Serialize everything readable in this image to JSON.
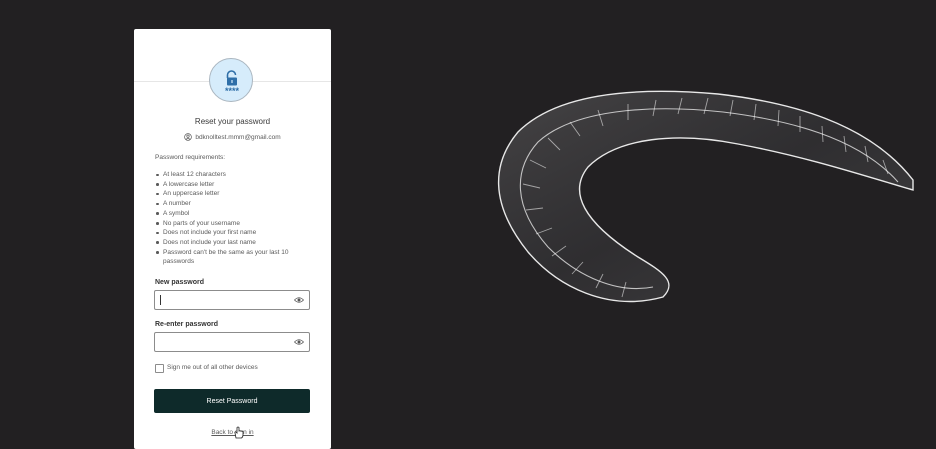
{
  "reset_card": {
    "title": "Reset your password",
    "account_email": "bdknolltest.mmm@gmail.com",
    "requirements_heading": "Password requirements:",
    "requirements": [
      "At least 12 characters",
      "A lowercase letter",
      "An uppercase letter",
      "A number",
      "A symbol",
      "No parts of your username",
      "Does not include your first name",
      "Does not include your last name",
      "Password can't be the same as your last 10 passwords"
    ],
    "new_password": {
      "label": "New password",
      "value": ""
    },
    "reenter_password": {
      "label": "Re-enter password",
      "value": ""
    },
    "sign_out_checkbox": {
      "label": "Sign me out of all other devices",
      "checked": false
    },
    "submit_label": "Reset Password",
    "back_link": "Back to sign in",
    "badge_text": "****"
  },
  "icons": {
    "badge": "lock-icon",
    "account": "user-circle-icon",
    "password_toggle": "eye-icon"
  },
  "colors": {
    "background": "#222022",
    "card": "#ffffff",
    "primary_button": "#0e2a2a",
    "badge_fill": "#d6ecfb",
    "badge_accent": "#2f6fa8"
  }
}
